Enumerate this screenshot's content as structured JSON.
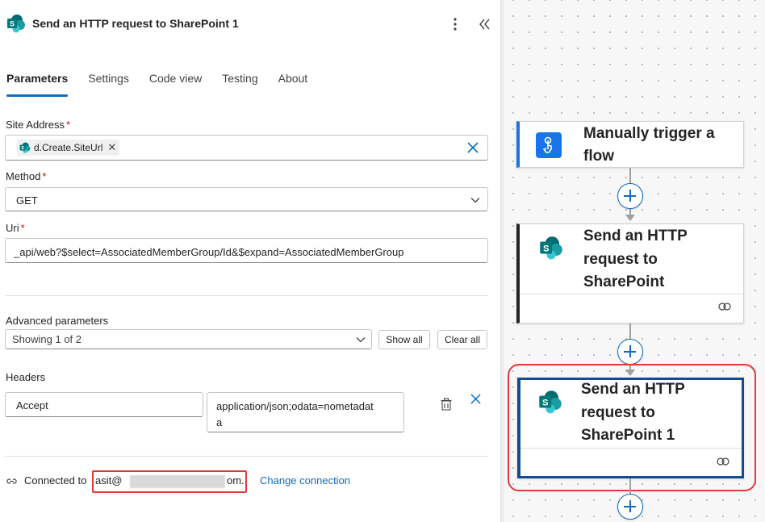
{
  "panel": {
    "title": "Send an HTTP request to SharePoint 1",
    "tabs": [
      "Parameters",
      "Settings",
      "Code view",
      "Testing",
      "About"
    ],
    "site_address": {
      "label": "Site Address",
      "required": "*",
      "token": "d.Create.SiteUrl",
      "token_close": "✕"
    },
    "method": {
      "label": "Method",
      "required": "*",
      "value": "GET"
    },
    "uri": {
      "label": "Uri",
      "required": "*",
      "value": "_api/web?$select=AssociatedMemberGroup/Id&$expand=AssociatedMemberGroup"
    },
    "advanced": {
      "label": "Advanced parameters",
      "value": "Showing 1 of 2",
      "show_all": "Show all",
      "clear_all": "Clear all"
    },
    "headers": {
      "label": "Headers",
      "key": "Accept",
      "value_line1": "application/json;odata=nometadat",
      "value_line2": "a"
    },
    "connection": {
      "label": "Connected to",
      "email_start": "asit@",
      "email_end": "om.",
      "change_link": "Change connection"
    }
  },
  "flow": {
    "nodes": [
      {
        "title_lines": [
          "Manually trigger a",
          "flow"
        ],
        "icon": "touch-trigger-icon"
      },
      {
        "title_lines": [
          "Send an HTTP",
          "request to",
          "SharePoint"
        ],
        "icon": "sharepoint-icon"
      },
      {
        "title_lines": [
          "Send an HTTP",
          "request to",
          "SharePoint 1"
        ],
        "icon": "sharepoint-icon"
      }
    ]
  },
  "colors": {
    "accent": "#0f6cbd",
    "required": "#c50f1f",
    "highlight": "#e03a3a",
    "trigger_bar": "#1a73e8",
    "selected_node_border": "#124c8f"
  }
}
